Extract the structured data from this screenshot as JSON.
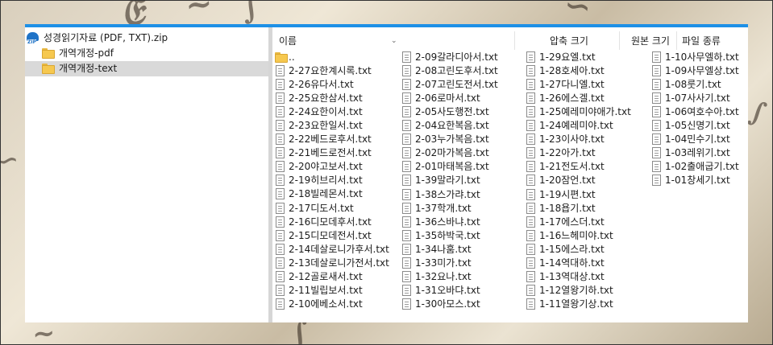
{
  "tree": {
    "root": {
      "label": "성경읽기자료 (PDF, TXT).zip",
      "icon": "zip-icon"
    },
    "children": [
      {
        "label": "개역개정-pdf",
        "icon": "folder-icon",
        "selected": false
      },
      {
        "label": "개역개정-text",
        "icon": "folder-icon",
        "selected": true
      }
    ]
  },
  "columns": {
    "name": "이름",
    "compressed_size": "압축 크기",
    "original_size": "원본 크기",
    "file_type": "파일 종류"
  },
  "up_folder": "..",
  "files_col1": [
    "2-27요한계시록.txt",
    "2-26유다서.txt",
    "2-25요한삼서.txt",
    "2-24요한이서.txt",
    "2-23요한일서.txt",
    "2-22베드로후서.txt",
    "2-21베드로전서.txt",
    "2-20야고보서.txt",
    "2-19히브리서.txt",
    "2-18빌레몬서.txt",
    "2-17디도서.txt",
    "2-16디모데후서.txt",
    "2-15디모데전서.txt",
    "2-14데살로니가후서.txt",
    "2-13데살로니가전서.txt",
    "2-12골로새서.txt",
    "2-11빌립보서.txt",
    "2-10에베소서.txt"
  ],
  "files_col2": [
    "2-09갈라디아서.txt",
    "2-08고린도후서.txt",
    "2-07고린도전서.txt",
    "2-06로마서.txt",
    "2-05사도행전.txt",
    "2-04요한복음.txt",
    "2-03누가복음.txt",
    "2-02마가복음.txt",
    "2-01마태복음.txt",
    "1-39말라기.txt",
    "1-38스가랴.txt",
    "1-37학개.txt",
    "1-36스바냐.txt",
    "1-35하박국.txt",
    "1-34나훔.txt",
    "1-33미가.txt",
    "1-32요나.txt",
    "1-31오바댜.txt",
    "1-30아모스.txt"
  ],
  "files_col3": [
    "1-29요엘.txt",
    "1-28호세아.txt",
    "1-27다니엘.txt",
    "1-26에스겔.txt",
    "1-25예레미야애가.txt",
    "1-24예레미야.txt",
    "1-23이사야.txt",
    "1-22아가.txt",
    "1-21전도서.txt",
    "1-20잠언.txt",
    "1-19시편.txt",
    "1-18욥기.txt",
    "1-17에스더.txt",
    "1-16느헤미야.txt",
    "1-15에스라.txt",
    "1-14역대하.txt",
    "1-13역대상.txt",
    "1-12열왕기하.txt",
    "1-11열왕기상.txt"
  ],
  "files_col4": [
    "1-10사무엘하.txt",
    "1-09사무엘상.txt",
    "1-08룻기.txt",
    "1-07사사기.txt",
    "1-06여호수아.txt",
    "1-05신명기.txt",
    "1-04민수기.txt",
    "1-03레위기.txt",
    "1-02출애굽기.txt",
    "1-01창세기.txt"
  ],
  "colors": {
    "accent": "#1e90e6",
    "selection": "#d9d9d9",
    "folder": "#f6c84f"
  }
}
